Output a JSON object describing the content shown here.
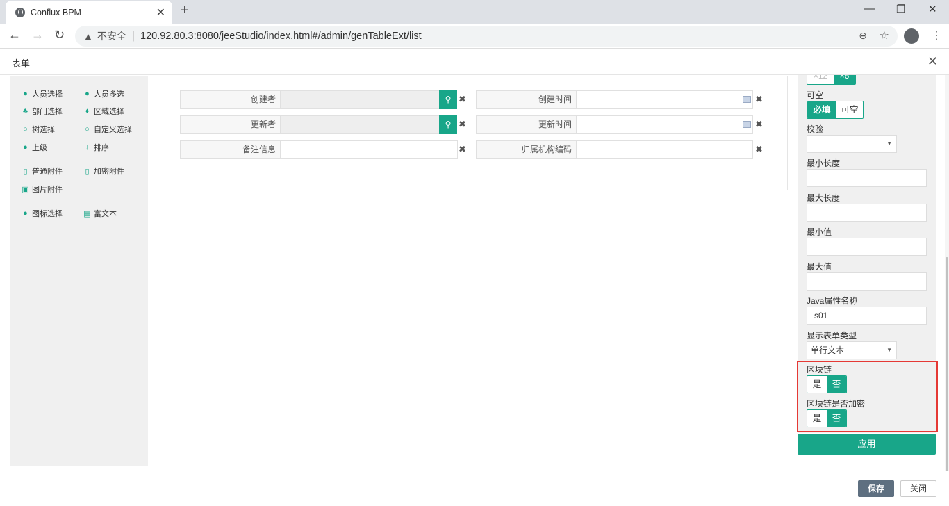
{
  "browser": {
    "tab_title": "Conflux BPM",
    "insecure_label": "不安全",
    "url": "120.92.80.3:8080/jeeStudio/index.html#/admin/genTableExt/list"
  },
  "dialog": {
    "title": "表单"
  },
  "sidebar": {
    "items": [
      {
        "label": "人员选择",
        "icon": "user-icon"
      },
      {
        "label": "人员多选",
        "icon": "users-icon"
      },
      {
        "label": "部门选择",
        "icon": "sitemap-icon"
      },
      {
        "label": "区域选择",
        "icon": "map-pin-icon"
      },
      {
        "label": "树选择",
        "icon": "search-icon"
      },
      {
        "label": "自定义选择",
        "icon": "search-icon"
      },
      {
        "label": "上级",
        "icon": "user-icon"
      },
      {
        "label": "排序",
        "icon": "sort-icon"
      },
      {
        "label": "普通附件",
        "icon": "file-icon"
      },
      {
        "label": "加密附件",
        "icon": "file-lock-icon"
      },
      {
        "label": "图片附件",
        "icon": "image-file-icon"
      },
      {
        "label": "图标选择",
        "icon": "user-icon"
      },
      {
        "label": "富文本",
        "icon": "doc-icon"
      }
    ]
  },
  "form": {
    "fields": [
      {
        "label": "创建者"
      },
      {
        "label": "创建时间"
      },
      {
        "label": "更新者"
      },
      {
        "label": "更新时间"
      },
      {
        "label": "备注信息"
      },
      {
        "label": "归属机构编码"
      }
    ]
  },
  "props": {
    "partial_top": [
      "×12",
      "×6"
    ],
    "nullable_label": "可空",
    "nullable_options": [
      "必填",
      "可空"
    ],
    "validate_label": "校验",
    "min_len_label": "最小长度",
    "max_len_label": "最大长度",
    "min_val_label": "最小值",
    "max_val_label": "最大值",
    "java_attr_label": "Java属性名称",
    "java_attr_value": "s01",
    "show_type_label": "显示表单类型",
    "show_type_value": "单行文本",
    "blockchain_label": "区块链",
    "blockchain_options": [
      "是",
      "否"
    ],
    "blockchain_encrypt_label": "区块链是否加密",
    "blockchain_encrypt_options": [
      "是",
      "否"
    ],
    "apply_label": "应用"
  },
  "footer": {
    "save_label": "保存",
    "close_label": "关闭"
  },
  "colors": {
    "accent": "#18a689",
    "highlight": "#e53935",
    "save": "#5e6f80"
  }
}
